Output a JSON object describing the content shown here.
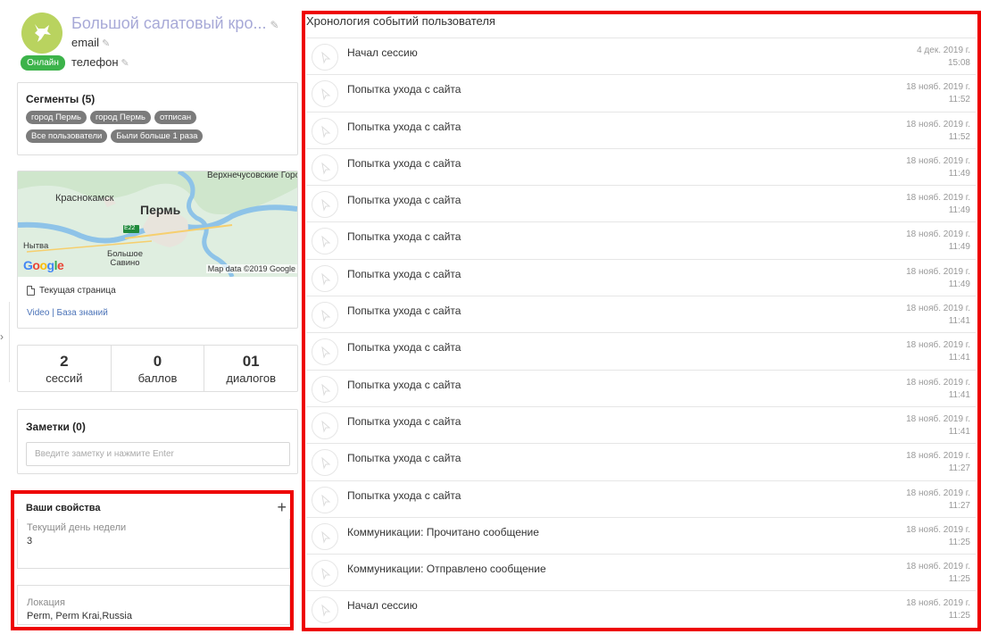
{
  "user": {
    "name": "Большой салатовый кро...",
    "email": "email",
    "phone": "телефон",
    "status": "Онлайн",
    "avatar_color": "#b9d35f",
    "status_color": "#3cb34a"
  },
  "segments": {
    "title": "Сегменты (5)",
    "chips": [
      "город Пермь",
      "город Пермь",
      "отписан",
      "Все пользователи",
      "Были больше 1 раза"
    ]
  },
  "map": {
    "labels": {
      "city_top_right": "Верхнечусовские Городки",
      "city_left": "Краснокамск",
      "city_main": "Пермь",
      "road": "E22",
      "river": "Нытва",
      "suburb": "Большое Савино"
    },
    "google": "Google",
    "copyright": "Map data ©2019 Google"
  },
  "current_page": {
    "label": "Текущая страница"
  },
  "links": {
    "text": "Video | База знаний"
  },
  "stats": [
    {
      "value": "2",
      "label": "сессий"
    },
    {
      "value": "0",
      "label": "баллов"
    },
    {
      "value": "01",
      "label": "диалогов"
    }
  ],
  "notes": {
    "title": "Заметки (0)",
    "placeholder": "Введите заметку и нажмите Enter"
  },
  "properties": {
    "title": "Ваши свойства",
    "add_icon": "plus-icon",
    "items": [
      {
        "label": "Текущий день недели",
        "value": "3"
      },
      {
        "label": "Локация",
        "value": "Perm, Perm Krai,Russia"
      }
    ]
  },
  "timeline": {
    "title": "Хронология событий пользователя",
    "events": [
      {
        "text": "Начал сессию",
        "date": "4 дек. 2019 г.",
        "time": "15:08"
      },
      {
        "text": "Попытка ухода с сайта",
        "date": "18 нояб. 2019 г.",
        "time": "11:52"
      },
      {
        "text": "Попытка ухода с сайта",
        "date": "18 нояб. 2019 г.",
        "time": "11:52"
      },
      {
        "text": "Попытка ухода с сайта",
        "date": "18 нояб. 2019 г.",
        "time": "11:49"
      },
      {
        "text": "Попытка ухода с сайта",
        "date": "18 нояб. 2019 г.",
        "time": "11:49"
      },
      {
        "text": "Попытка ухода с сайта",
        "date": "18 нояб. 2019 г.",
        "time": "11:49"
      },
      {
        "text": "Попытка ухода с сайта",
        "date": "18 нояб. 2019 г.",
        "time": "11:49"
      },
      {
        "text": "Попытка ухода с сайта",
        "date": "18 нояб. 2019 г.",
        "time": "11:41"
      },
      {
        "text": "Попытка ухода с сайта",
        "date": "18 нояб. 2019 г.",
        "time": "11:41"
      },
      {
        "text": "Попытка ухода с сайта",
        "date": "18 нояб. 2019 г.",
        "time": "11:41"
      },
      {
        "text": "Попытка ухода с сайта",
        "date": "18 нояб. 2019 г.",
        "time": "11:41"
      },
      {
        "text": "Попытка ухода с сайта",
        "date": "18 нояб. 2019 г.",
        "time": "11:27"
      },
      {
        "text": "Попытка ухода с сайта",
        "date": "18 нояб. 2019 г.",
        "time": "11:27"
      },
      {
        "text": "Коммуникации: Прочитано сообщение",
        "date": "18 нояб. 2019 г.",
        "time": "11:25"
      },
      {
        "text": "Коммуникации: Отправлено сообщение",
        "date": "18 нояб. 2019 г.",
        "time": "11:25"
      },
      {
        "text": "Начал сессию",
        "date": "18 нояб. 2019 г.",
        "time": "11:25"
      }
    ]
  },
  "colors": {
    "highlight": "#ee0000",
    "link": "#4b73b8",
    "name": "#a7a9d7"
  }
}
